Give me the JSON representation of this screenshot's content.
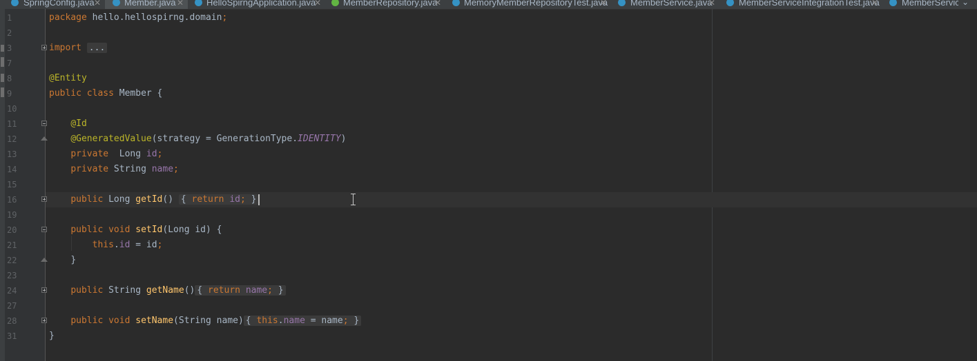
{
  "tabs": [
    {
      "label": "SpringConfig.java",
      "icon": "class-icon",
      "active": false
    },
    {
      "label": "Member.java",
      "icon": "class-icon",
      "active": true
    },
    {
      "label": "HelloSpirngApplication.java",
      "icon": "class-icon",
      "active": false
    },
    {
      "label": "MemberRepository.java",
      "icon": "interface-icon",
      "active": false
    },
    {
      "label": "MemoryMemberRepositoryTest.java",
      "icon": "class-icon",
      "active": false
    },
    {
      "label": "MemberService.java",
      "icon": "class-icon",
      "active": false
    },
    {
      "label": "MemberServiceIntegrationTest.java",
      "icon": "class-icon",
      "active": false
    },
    {
      "label": "MemberServic",
      "icon": "class-icon",
      "active": false
    }
  ],
  "tab_close": "✕",
  "tab_menu": "⌄",
  "editor": {
    "line_numbers": [
      "1",
      "2",
      "3",
      "7",
      "8",
      "9",
      "10",
      "11",
      "12",
      "13",
      "14",
      "15",
      "16",
      "19",
      "20",
      "21",
      "22",
      "23",
      "24",
      "27",
      "28",
      "31"
    ],
    "tokens": {
      "package_kw": "package",
      "package_name": " hello.hellospirng.domain",
      "semicolon": ";",
      "import_kw": "import",
      "import_fold": "...",
      "entity_ann": "@Entity",
      "public_kw": "public",
      "class_kw": "class",
      "class_name": " Member {",
      "id_ann": "@Id",
      "generated_ann": "@GeneratedValue",
      "strategy_text": "(strategy = GenerationType.",
      "identity_const": "IDENTITY",
      "close_paren": ")",
      "private_kw": "private",
      "long_type": "  Long ",
      "id_field": "id",
      "string_type": " String ",
      "name_field": "name",
      "long_type2": " Long ",
      "getid_fn": "getId",
      "parens": "()",
      "open_brace": "{",
      "close_brace": "}",
      "return_kw": "return",
      "void_kw": "void",
      "setid_fn": "setId",
      "setid_params": "(Long id) {",
      "this_kw": "this",
      "dot": ".",
      "assign_id": " = id",
      "getname_fn": "getName",
      "setname_fn": "setName",
      "setname_params": "(String name)",
      "assign_name": " = name"
    }
  }
}
